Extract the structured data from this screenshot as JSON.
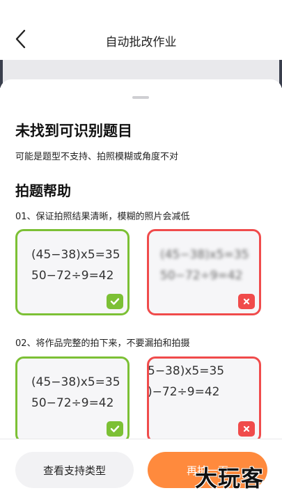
{
  "header": {
    "title": "自动批改作业",
    "back_icon": "chevron-left-icon"
  },
  "sheet": {
    "heading": "未找到可识别题目",
    "subheading": "可能是题型不支持、拍照模糊或角度不对",
    "help_title": "拍题帮助",
    "tips": [
      {
        "text": "01、保证拍照结果清晰，模糊的照片会减低",
        "good": {
          "lines": [
            "(45−38)x5=35",
            "50−72÷9=42"
          ],
          "badge_icon": "check-icon"
        },
        "bad": {
          "lines": [
            "(45−38)x5=35",
            "50−72÷9=42"
          ],
          "badge_icon": "cross-icon"
        }
      },
      {
        "text": "02、将作品完整的拍下来，不要漏拍和拍摄",
        "good": {
          "lines": [
            "(45−38)x5=35",
            "50−72÷9=42"
          ],
          "badge_icon": "check-icon"
        },
        "bad": {
          "lines": [
            "5−38)x5=35",
            ")−72÷9=42"
          ],
          "badge_icon": "cross-icon"
        }
      }
    ]
  },
  "footer": {
    "secondary_label": "查看支持类型",
    "primary_label": "再拍一页"
  },
  "watermark": "大玩客",
  "colors": {
    "accent": "#ff8a3d",
    "good": "#7cc035",
    "bad": "#f04b4b"
  }
}
